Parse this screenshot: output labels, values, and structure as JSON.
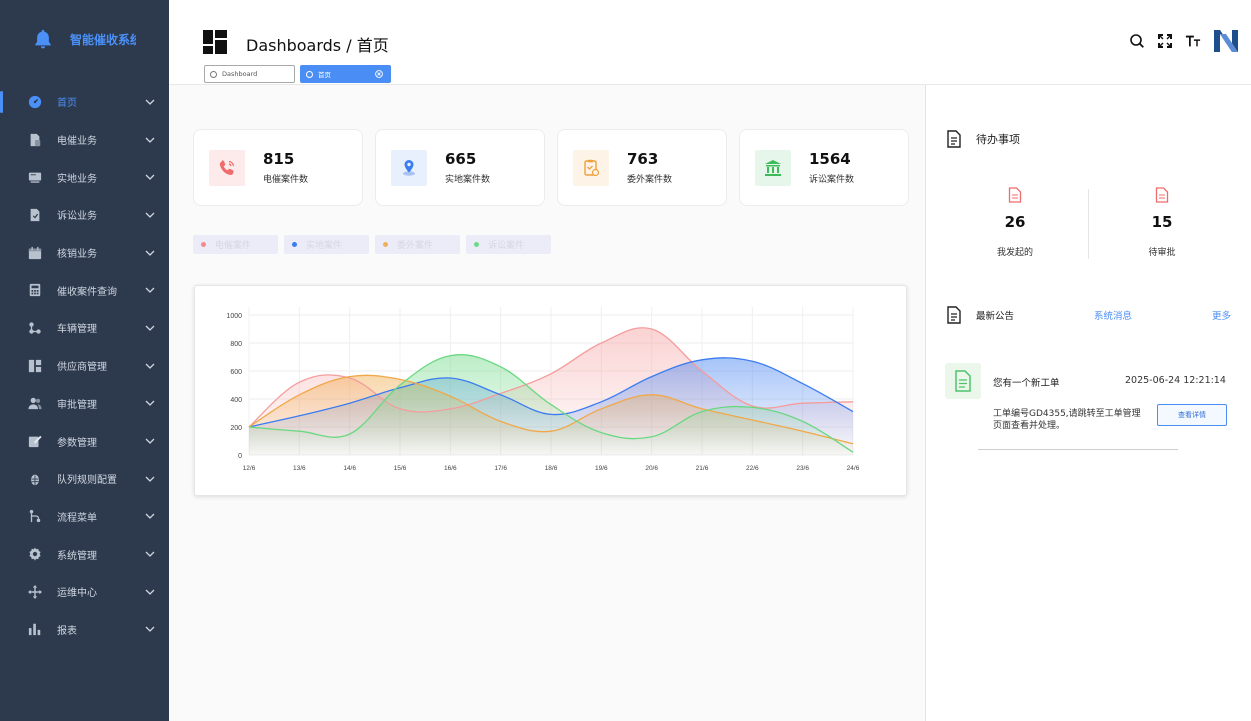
{
  "brand": {
    "title": "智能催收系统"
  },
  "sidebar": {
    "items": [
      {
        "label": "首页",
        "icon": "dashboard-gauge-icon",
        "active": true
      },
      {
        "label": "电催业务",
        "icon": "phone-doc-icon"
      },
      {
        "label": "实地业务",
        "icon": "field-visit-icon"
      },
      {
        "label": "诉讼业务",
        "icon": "lawsuit-doc-icon"
      },
      {
        "label": "核销业务",
        "icon": "calendar-icon"
      },
      {
        "label": "催收案件查询",
        "icon": "calculator-icon"
      },
      {
        "label": "车辆管理",
        "icon": "nodes-icon"
      },
      {
        "label": "供应商管理",
        "icon": "supplier-grid-icon"
      },
      {
        "label": "审批管理",
        "icon": "users-icon"
      },
      {
        "label": "参数管理",
        "icon": "edit-icon"
      },
      {
        "label": "队列规则配置",
        "icon": "bug-icon"
      },
      {
        "label": "流程菜单",
        "icon": "flow-icon"
      },
      {
        "label": "系统管理",
        "icon": "gear-icon"
      },
      {
        "label": "运维中心",
        "icon": "move-arrows-icon"
      },
      {
        "label": "报表",
        "icon": "bar-chart-icon"
      }
    ]
  },
  "header": {
    "title": "Dashboards / 首页",
    "tabs": [
      {
        "label": "Dashboard",
        "active": false
      },
      {
        "label": "首页",
        "active": true
      }
    ],
    "icons": [
      "search-icon",
      "fullscreen-icon",
      "font-size-icon",
      "brand-logo-icon"
    ]
  },
  "stats": [
    {
      "value": "815",
      "label": "电催案件数",
      "icon": "phone-icon",
      "color": "#f06b6b",
      "bg": "#fdeaea"
    },
    {
      "value": "665",
      "label": "实地案件数",
      "icon": "location-icon",
      "color": "#3b7cf0",
      "bg": "#e8effd"
    },
    {
      "value": "763",
      "label": "委外案件数",
      "icon": "clipboard-icon",
      "color": "#f0a03b",
      "bg": "#fdf3e6"
    },
    {
      "value": "1564",
      "label": "诉讼案件数",
      "icon": "bank-icon",
      "color": "#3dbb58",
      "bg": "#e7f6ea"
    }
  ],
  "legend": [
    {
      "label": "电催案件",
      "color": "#f28b8b"
    },
    {
      "label": "实地案件",
      "color": "#3b7cf0"
    },
    {
      "label": "委外案件",
      "color": "#f0b060"
    },
    {
      "label": "诉讼案件",
      "color": "#6fd98a"
    }
  ],
  "chart_data": {
    "type": "area",
    "categories": [
      "12/6",
      "13/6",
      "14/6",
      "15/6",
      "16/6",
      "17/6",
      "18/6",
      "19/6",
      "20/6",
      "21/6",
      "22/6",
      "23/6",
      "24/6"
    ],
    "ylim": [
      0,
      1000
    ],
    "yticks": [
      0,
      200,
      400,
      600,
      800,
      1000
    ],
    "grid": true,
    "series": [
      {
        "name": "电催案件",
        "color": "#f59c9c",
        "values": [
          200,
          520,
          550,
          330,
          330,
          440,
          580,
          800,
          900,
          600,
          350,
          370,
          380
        ]
      },
      {
        "name": "实地案件",
        "color": "#3b7cf0",
        "values": [
          200,
          280,
          370,
          480,
          550,
          430,
          290,
          380,
          560,
          680,
          670,
          510,
          310
        ]
      },
      {
        "name": "委外案件",
        "color": "#f0a848",
        "values": [
          200,
          430,
          560,
          540,
          420,
          240,
          170,
          330,
          430,
          330,
          250,
          170,
          80
        ]
      },
      {
        "name": "诉讼案件",
        "color": "#6ad882",
        "values": [
          200,
          170,
          150,
          500,
          710,
          630,
          360,
          160,
          130,
          310,
          340,
          240,
          20
        ]
      }
    ]
  },
  "todo": {
    "title": "待办事项",
    "items": [
      {
        "value": "26",
        "label": "我发起的"
      },
      {
        "value": "15",
        "label": "待审批"
      }
    ]
  },
  "notices": {
    "title": "最新公告",
    "system_link": "系统消息",
    "more_link": "更多",
    "items": [
      {
        "title": "您有一个新工单",
        "time": "2025-06-24 12:21:14",
        "body": "工单编号GD4355,请跳转至工单管理页面查看并处理。",
        "button": "查看详情"
      }
    ]
  }
}
